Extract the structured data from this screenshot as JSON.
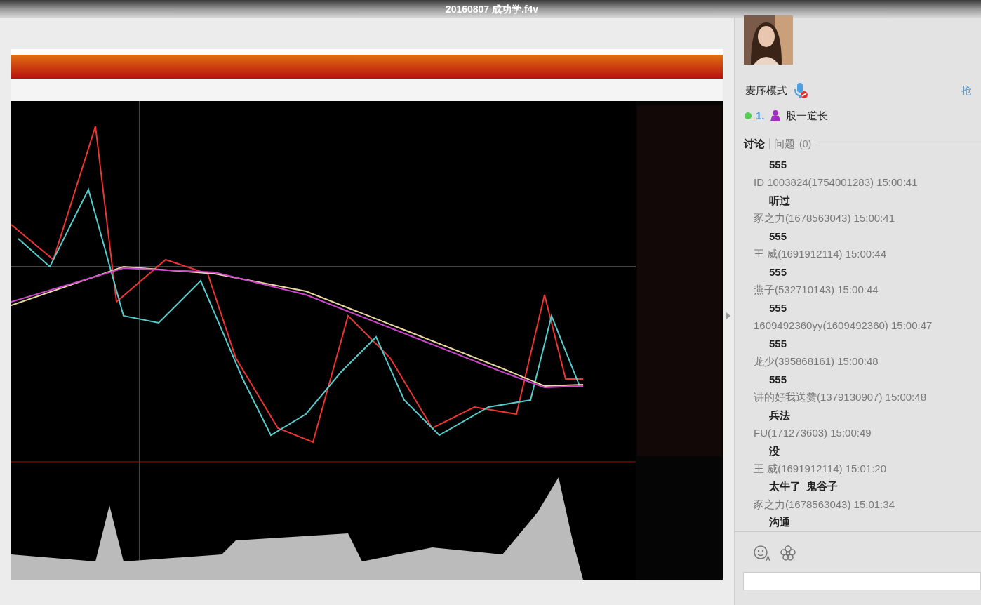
{
  "window": {
    "title": "20160807 成功学.f4v"
  },
  "host_panel": {
    "mode_label": "麦序模式",
    "grab_mic": "抢",
    "queue": [
      {
        "number": "1.",
        "name": "股一道长",
        "online": true
      }
    ]
  },
  "tabs": [
    {
      "label": "讨论",
      "selected": true
    },
    {
      "label": "问题",
      "count": "(0)",
      "selected": false
    }
  ],
  "messages": [
    {
      "text": "555"
    },
    {
      "header": "ID 1003824(1754001283) 15:00:41",
      "text": "听过"
    },
    {
      "header": "豕之力(1678563043) 15:00:41",
      "text": "555"
    },
    {
      "header": "王 威(1691912114) 15:00:44",
      "text": "555"
    },
    {
      "header": "燕子(532710143) 15:00:44",
      "text": "555"
    },
    {
      "header": "1609492360yy(1609492360) 15:00:47",
      "text": "555"
    },
    {
      "header": "龙少(395868161) 15:00:48",
      "text": "555"
    },
    {
      "header": "讲的好我送赞(1379130907) 15:00:48",
      "text": "兵法"
    },
    {
      "header": "FU(171273603) 15:00:49",
      "text": "没"
    },
    {
      "header": "王 威(1691912114) 15:01:20",
      "text": "太牛了  鬼谷子"
    },
    {
      "header": "豕之力(1678563043) 15:01:34",
      "text": "沟通"
    }
  ]
}
